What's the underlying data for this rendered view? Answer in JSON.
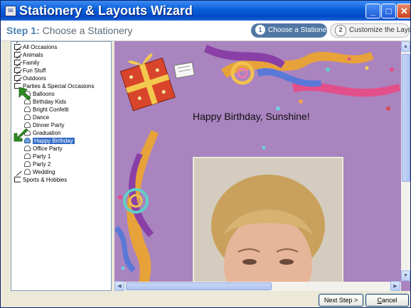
{
  "window": {
    "title": "Stationery & Layouts Wizard",
    "minimize": "_",
    "maximize": "□",
    "close": "✕"
  },
  "step": {
    "prefix": "Step 1:",
    "title": "Choose a Stationery"
  },
  "steps": [
    {
      "num": "1",
      "label": "Choose a Stationery",
      "state": "active"
    },
    {
      "num": "2",
      "label": "Customize the Layout",
      "state": "inactive"
    }
  ],
  "tree": {
    "categories": [
      "All Occasions",
      "Animals",
      "Family",
      "Fun Stuff",
      "Outdoors",
      "Parties & Special Occasions"
    ],
    "subitems": [
      "Balloons",
      "Birthday Kids",
      "Bright Confetti",
      "Dance",
      "Dinner Party",
      "Graduation",
      "Happy Birthday",
      "Office Party",
      "Party 1",
      "Party 2",
      "Wedding"
    ],
    "selected": "Happy Birthday",
    "last_category": "Sports & Hobbies"
  },
  "preview": {
    "greeting": "Happy Birthday, Sunshine!"
  },
  "buttons": {
    "next": "Next Step >",
    "cancel_u": "C",
    "cancel_rest": "ancel"
  },
  "colors": {
    "titlebar": "#0349c6",
    "preview_bg": "#a984bf",
    "selection": "#316ac5",
    "arrow": "#2e8b22"
  }
}
